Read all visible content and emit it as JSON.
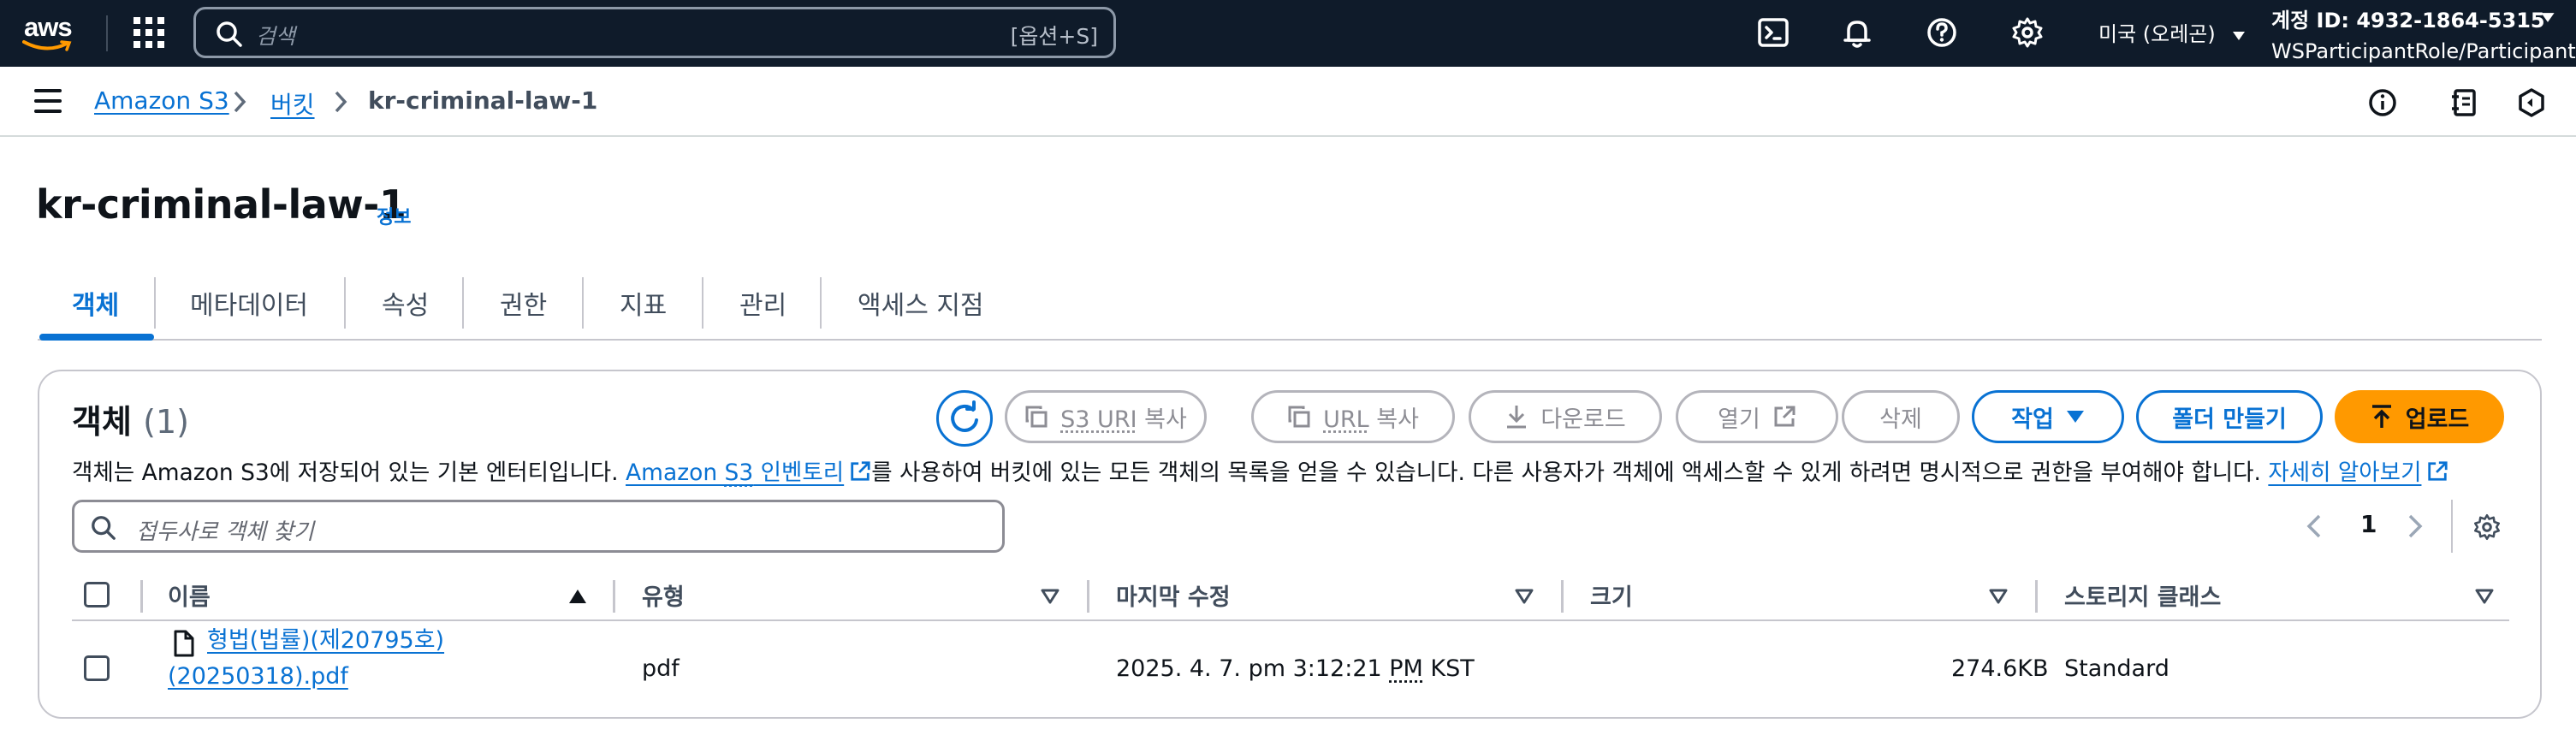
{
  "topnav": {
    "logo_text": "aws",
    "search_placeholder": "검색",
    "search_shortcut": "[옵션+S]",
    "region": "미국 (오레곤)",
    "account_id": "계정 ID: 4932-1864-5315",
    "account_role": "WSParticipantRole/Participant"
  },
  "breadcrumb": {
    "items": [
      "Amazon S3",
      "버킷",
      "kr-criminal-law-1"
    ]
  },
  "page": {
    "title": "kr-criminal-law-1",
    "info_label": "정보"
  },
  "tabs": [
    "객체",
    "메타데이터",
    "속성",
    "권한",
    "지표",
    "관리",
    "액세스 지점"
  ],
  "objects": {
    "title": "객체",
    "count": "(1)",
    "buttons": {
      "copy_s3_uri_prefix": "S3 URI",
      "copy_s3_uri_suffix": "복사",
      "copy_url_prefix": "URL",
      "copy_url_suffix": "복사",
      "download": "다운로드",
      "open": "열기",
      "delete": "삭제",
      "actions": "작업",
      "create_folder": "폴더 만들기",
      "upload": "업로드"
    },
    "description": {
      "part1": "객체는 Amazon S3에 저장되어 있는 기본 엔터티입니다. ",
      "link1_a": "Amazon ",
      "link1_b": "S3",
      "link1_c": " 인벤토리",
      "part2": "를 사용하여 버킷에 있는 모든 객체의 목록을 얻을 수 있습니다. 다른 사용자가 객체에 액세스할 수 있게 하려면 명시적으로 권한을 부여해야 합니다. ",
      "link2": "자세히 알아보기"
    },
    "filter_placeholder": "접두사로 객체 찾기",
    "page_number": "1",
    "columns": [
      "이름",
      "유형",
      "마지막 수정",
      "크기",
      "스토리지 클래스"
    ],
    "rows": [
      {
        "name_line1": "형법(법률)(제20795호)",
        "name_line2": "(20250318).pdf",
        "type": "pdf",
        "modified_a": "2025. 4. 7. pm 3:12:21 ",
        "modified_b": "PM",
        "modified_c": " KST",
        "size": "274.6KB",
        "storage_class": "Standard"
      }
    ]
  },
  "colors": {
    "nav_bg": "#0f1b2a",
    "link": "#0972d3",
    "primary": "#ff9900",
    "border": "#c6c6cd"
  },
  "icons": [
    "search-icon",
    "apps-grid-icon",
    "cloudshell-icon",
    "bell-icon",
    "help-icon",
    "settings-icon",
    "hamburger-icon",
    "info-icon",
    "refresh-icon",
    "copy-icon",
    "download-icon",
    "external-link-icon",
    "upload-icon",
    "file-icon",
    "gear-icon"
  ]
}
